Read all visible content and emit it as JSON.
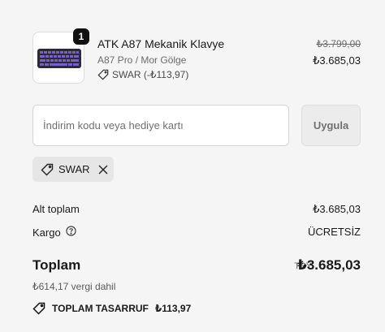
{
  "product": {
    "quantity": "1",
    "name": "ATK A87 Mekanik Klavye",
    "variant": "A87 Pro / Mor Gölge",
    "discount_tag": "SWAR (-₺113,97)",
    "original_price": "₺3.799,00",
    "price": "₺3.685,03"
  },
  "discount_form": {
    "placeholder": "İndirim kodu veya hediye kartı",
    "value": "",
    "apply_label": "Uygula"
  },
  "applied_code": {
    "label": "SWAR"
  },
  "summary": {
    "subtotal_label": "Alt toplam",
    "subtotal_value": "₺3.685,03",
    "shipping_label": "Kargo",
    "shipping_value": "ÜCRETSİZ",
    "total_label": "Toplam",
    "currency_code": "TRY",
    "total_value": "₺3.685,03",
    "tax_note": "₺614,17 vergi dahil",
    "savings_label": "TOPLAM TASARRUF",
    "savings_value": "₺113,97"
  },
  "colors": {
    "background": "#f5f5f5",
    "keyboard_keys": "#7b5fc9",
    "badge": "#111111"
  },
  "icons": [
    "tag-icon",
    "close-icon",
    "help-circle-icon",
    "keyboard-image"
  ]
}
